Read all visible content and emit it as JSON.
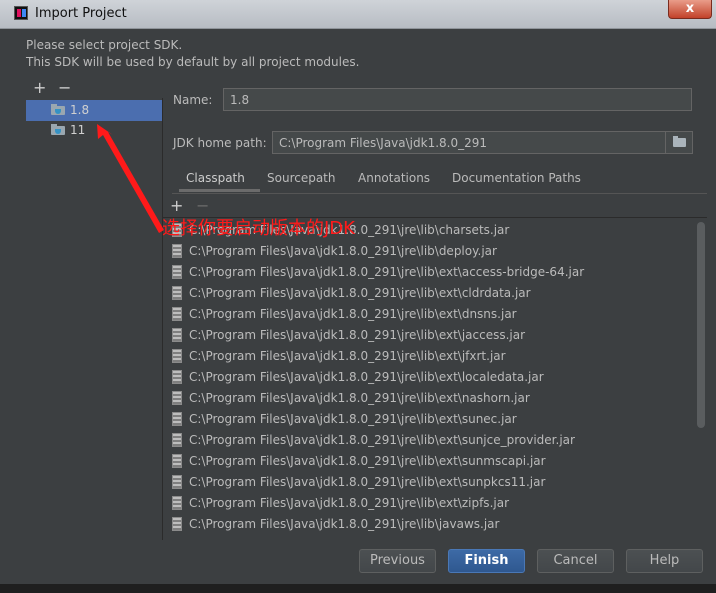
{
  "window": {
    "title": "Import Project",
    "close_label": "x"
  },
  "description": {
    "line1": "Please select project SDK.",
    "line2": "This SDK will be used by default by all project modules."
  },
  "sdk_toolbar": {
    "add": "+",
    "remove": "−"
  },
  "sdks": [
    {
      "label": "1.8",
      "selected": true
    },
    {
      "label": "11",
      "selected": false
    }
  ],
  "form": {
    "name_label": "Name:",
    "name_value": "1.8",
    "home_label": "JDK home path:",
    "home_value": "C:\\Program Files\\Java\\jdk1.8.0_291"
  },
  "tabs": [
    "Classpath",
    "Sourcepath",
    "Annotations",
    "Documentation Paths"
  ],
  "list_toolbar": {
    "add": "+",
    "remove": "−"
  },
  "classpath": [
    "C:\\Program Files\\Java\\jdk1.8.0_291\\jre\\lib\\charsets.jar",
    "C:\\Program Files\\Java\\jdk1.8.0_291\\jre\\lib\\deploy.jar",
    "C:\\Program Files\\Java\\jdk1.8.0_291\\jre\\lib\\ext\\access-bridge-64.jar",
    "C:\\Program Files\\Java\\jdk1.8.0_291\\jre\\lib\\ext\\cldrdata.jar",
    "C:\\Program Files\\Java\\jdk1.8.0_291\\jre\\lib\\ext\\dnsns.jar",
    "C:\\Program Files\\Java\\jdk1.8.0_291\\jre\\lib\\ext\\jaccess.jar",
    "C:\\Program Files\\Java\\jdk1.8.0_291\\jre\\lib\\ext\\jfxrt.jar",
    "C:\\Program Files\\Java\\jdk1.8.0_291\\jre\\lib\\ext\\localedata.jar",
    "C:\\Program Files\\Java\\jdk1.8.0_291\\jre\\lib\\ext\\nashorn.jar",
    "C:\\Program Files\\Java\\jdk1.8.0_291\\jre\\lib\\ext\\sunec.jar",
    "C:\\Program Files\\Java\\jdk1.8.0_291\\jre\\lib\\ext\\sunjce_provider.jar",
    "C:\\Program Files\\Java\\jdk1.8.0_291\\jre\\lib\\ext\\sunmscapi.jar",
    "C:\\Program Files\\Java\\jdk1.8.0_291\\jre\\lib\\ext\\sunpkcs11.jar",
    "C:\\Program Files\\Java\\jdk1.8.0_291\\jre\\lib\\ext\\zipfs.jar",
    "C:\\Program Files\\Java\\jdk1.8.0_291\\jre\\lib\\javaws.jar"
  ],
  "annotation": {
    "text": "选择你要启动版本的JDK",
    "color": "#ff1a1a"
  },
  "buttons": {
    "previous": "Previous",
    "finish": "Finish",
    "cancel": "Cancel",
    "help": "Help"
  },
  "colors": {
    "background": "#3c3f41",
    "selection": "#4b6eaf",
    "primary_button": "#365880"
  }
}
